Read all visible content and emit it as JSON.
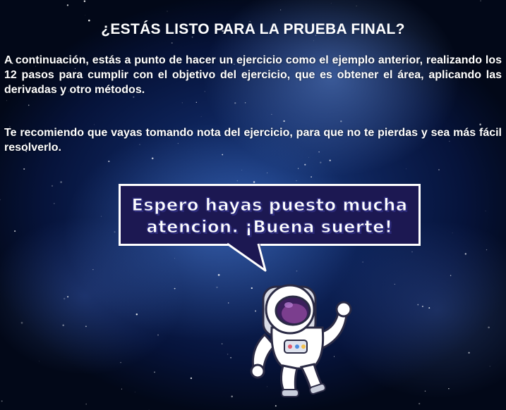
{
  "title": "¿ESTÁS LISTO PARA LA PRUEBA FINAL?",
  "paragraph_1": "A continuación, estás a punto de hacer un ejercicio como el ejemplo anterior, realizando los 12 pasos para cumplir con el objetivo del ejercicio, que es obtener el área, aplicando las derivadas y otro métodos.",
  "paragraph_2": "Te recomiendo que vayas tomando nota del ejercicio, para que no te pierdas y sea más fácil resolverlo.",
  "speech_bubble": {
    "line_1": "Espero hayas puesto mucha",
    "line_2": "atencion. ¡Buena suerte!"
  },
  "colors": {
    "background": "#0d2257",
    "bubble_fill": "#1c1852",
    "text": "#ffffff"
  },
  "icons": [
    "astronaut-illustration",
    "space-background"
  ]
}
